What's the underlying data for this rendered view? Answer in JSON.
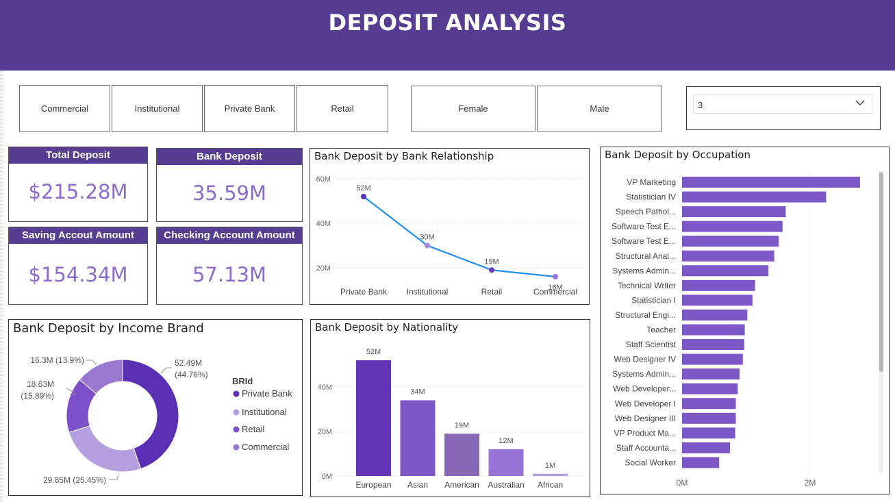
{
  "header": {
    "title": "DEPOSIT ANALYSIS"
  },
  "slicers": {
    "relationship": [
      "Commercial",
      "Institutional",
      "Private Bank",
      "Retail"
    ],
    "gender": [
      "Female",
      "Male"
    ],
    "dropdown_value": "3"
  },
  "cards": {
    "total_deposit": {
      "label": "Total Deposit",
      "value": "$215.28M"
    },
    "bank_deposit": {
      "label": "Bank Deposit",
      "value": "35.59M"
    },
    "saving_amount": {
      "label": "Saving Accout Amount",
      "value": "$154.34M"
    },
    "checking_amount": {
      "label": "Checking Account Amount",
      "value": "57.13M"
    }
  },
  "colors": {
    "header": "#563d92",
    "kpi_value": "#8c6bcb",
    "line": "#1f8ff0",
    "bar": "#7e57c6"
  },
  "chart_data": [
    {
      "id": "relationship",
      "type": "line",
      "title": "Bank Deposit by Bank Relationship",
      "categories": [
        "Private Bank",
        "Institutional",
        "Retail",
        "Commercial"
      ],
      "values": [
        52,
        30,
        19,
        16
      ],
      "data_labels": [
        "52M",
        "30M",
        "19M",
        "16M"
      ],
      "y_ticks": [
        "20M",
        "40M",
        "60M"
      ],
      "ylim": [
        0,
        60
      ],
      "point_colors": [
        "#5b2fb3",
        "#a88ae0",
        "#6b3cc4",
        "#9a70d8"
      ],
      "grid": true
    },
    {
      "id": "income",
      "type": "pie",
      "title": "Bank Deposit by Income Brand",
      "legend_title": "BRId",
      "legend_position": "right",
      "categories": [
        "Private Bank",
        "Institutional",
        "Retail",
        "Commercial"
      ],
      "values": [
        52.49,
        29.85,
        18.63,
        16.3
      ],
      "data_labels": [
        "52.49M (44.76%)",
        "29.85M (25.45%)",
        "18.63M (15.89%)",
        "16.3M (13.9%)"
      ],
      "colors": [
        "#5a2fb4",
        "#b4a0e0",
        "#7d4fc9",
        "#9a78d2"
      ]
    },
    {
      "id": "nationality",
      "type": "bar",
      "title": "Bank Deposit by Nationality",
      "categories": [
        "European",
        "Asian",
        "American",
        "Australian",
        "African"
      ],
      "values": [
        52,
        34,
        19,
        12,
        1
      ],
      "data_labels": [
        "52M",
        "34M",
        "19M",
        "12M",
        "1M"
      ],
      "y_ticks": [
        "0M",
        "20M",
        "40M"
      ],
      "ylim": [
        0,
        60
      ],
      "colors": [
        "#6236b5",
        "#7e57c6",
        "#8866b8",
        "#9673d4",
        "#b29ee4"
      ],
      "grid": true
    },
    {
      "id": "occupation",
      "type": "bar",
      "orientation": "horizontal",
      "title": "Bank Deposit by Occupation",
      "categories": [
        "VP Marketing",
        "Statistician IV",
        "Speech Pathol...",
        "Software Test E...",
        "Software Test E...",
        "Structural Anal...",
        "Systems Admin...",
        "Technical Writer",
        "Statistician I",
        "Structural Engi...",
        "Teacher",
        "Staff Scientist",
        "Web Designer IV",
        "Systems Admin...",
        "Web Developer...",
        "Web Developer I",
        "Web Designer III",
        "VP Product Ma...",
        "Staff Accounta...",
        "Social Worker"
      ],
      "values": [
        2.78,
        2.25,
        1.62,
        1.57,
        1.51,
        1.44,
        1.35,
        1.14,
        1.1,
        1.02,
        0.98,
        0.97,
        0.95,
        0.9,
        0.87,
        0.84,
        0.84,
        0.83,
        0.75,
        0.58
      ],
      "x_ticks": [
        "0M",
        "2M"
      ],
      "xlim": [
        0,
        2.98
      ],
      "color": "#7e57c6",
      "grid": true
    }
  ]
}
